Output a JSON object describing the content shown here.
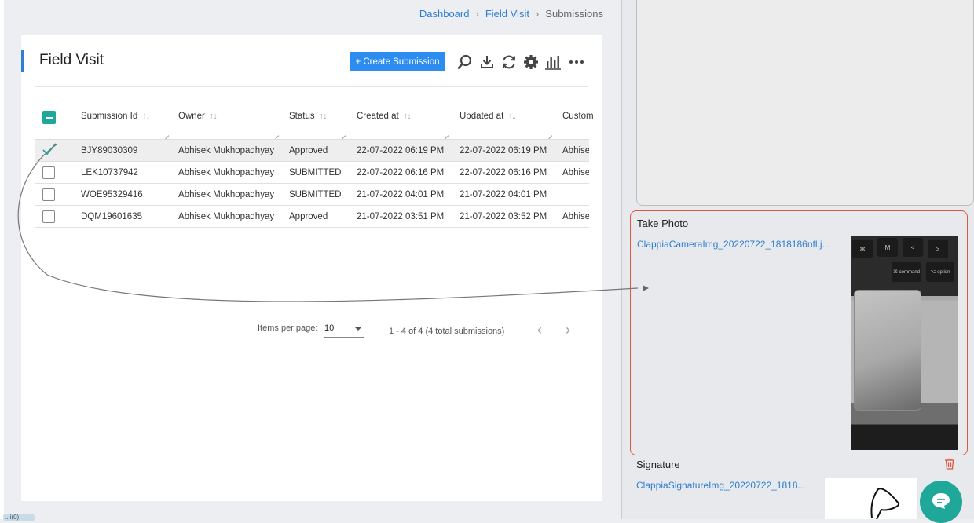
{
  "breadcrumb": {
    "dashboard": "Dashboard",
    "sep": "›",
    "field_visit": "Field Visit",
    "current": "Submissions"
  },
  "page": {
    "title": "Field Visit",
    "create_button": "+ Create Submission"
  },
  "table": {
    "headers": [
      "Submission Id",
      "Owner",
      "Status",
      "Created at",
      "Updated at",
      "Custom"
    ],
    "rows": [
      {
        "id": "BJY89030309",
        "owner": "Abhisek Mukhopadhyay",
        "status": "Approved",
        "created": "22-07-2022 06:19 PM",
        "updated": "22-07-2022 06:19 PM",
        "custom": "Abhisek",
        "checked": true
      },
      {
        "id": "LEK10737942",
        "owner": "Abhisek Mukhopadhyay",
        "status": "SUBMITTED",
        "created": "22-07-2022 06:16 PM",
        "updated": "22-07-2022 06:16 PM",
        "custom": "Abhisek",
        "checked": false
      },
      {
        "id": "WOE95329416",
        "owner": "Abhisek Mukhopadhyay",
        "status": "SUBMITTED",
        "created": "21-07-2022 04:01 PM",
        "updated": "21-07-2022 04:01 PM",
        "custom": "",
        "checked": false
      },
      {
        "id": "DQM19601635",
        "owner": "Abhisek Mukhopadhyay",
        "status": "Approved",
        "created": "21-07-2022 03:51 PM",
        "updated": "21-07-2022 03:52 PM",
        "custom": "Abhisek",
        "checked": false
      }
    ]
  },
  "pagination": {
    "items_label": "Items per page:",
    "items_value": "10",
    "range_text": "1 - 4 of 4 (4 total submissions)",
    "prev": "‹",
    "next": "›"
  },
  "detail": {
    "take_photo_label": "Take Photo",
    "photo_file": "ClappiaCameraImg_20220722_1818186nfl.j...",
    "signature_label": "Signature",
    "signature_file": "ClappiaSignatureImg_20220722_1818..."
  },
  "photo_keys": [
    "⌘",
    "M",
    "<",
    ">",
    "⌘\ncommand",
    "⌥\noption"
  ],
  "bottom_tag": "...i(0)",
  "colors": {
    "accent": "#2d8cf0",
    "link": "#2d7fd3",
    "teal": "#1fa89a",
    "highlight_border": "#e0563f"
  },
  "icons": [
    "search-icon",
    "download-icon",
    "refresh-icon",
    "settings-icon",
    "chart-icon",
    "more-icon",
    "trash-icon",
    "chat-icon",
    "check-icon"
  ]
}
